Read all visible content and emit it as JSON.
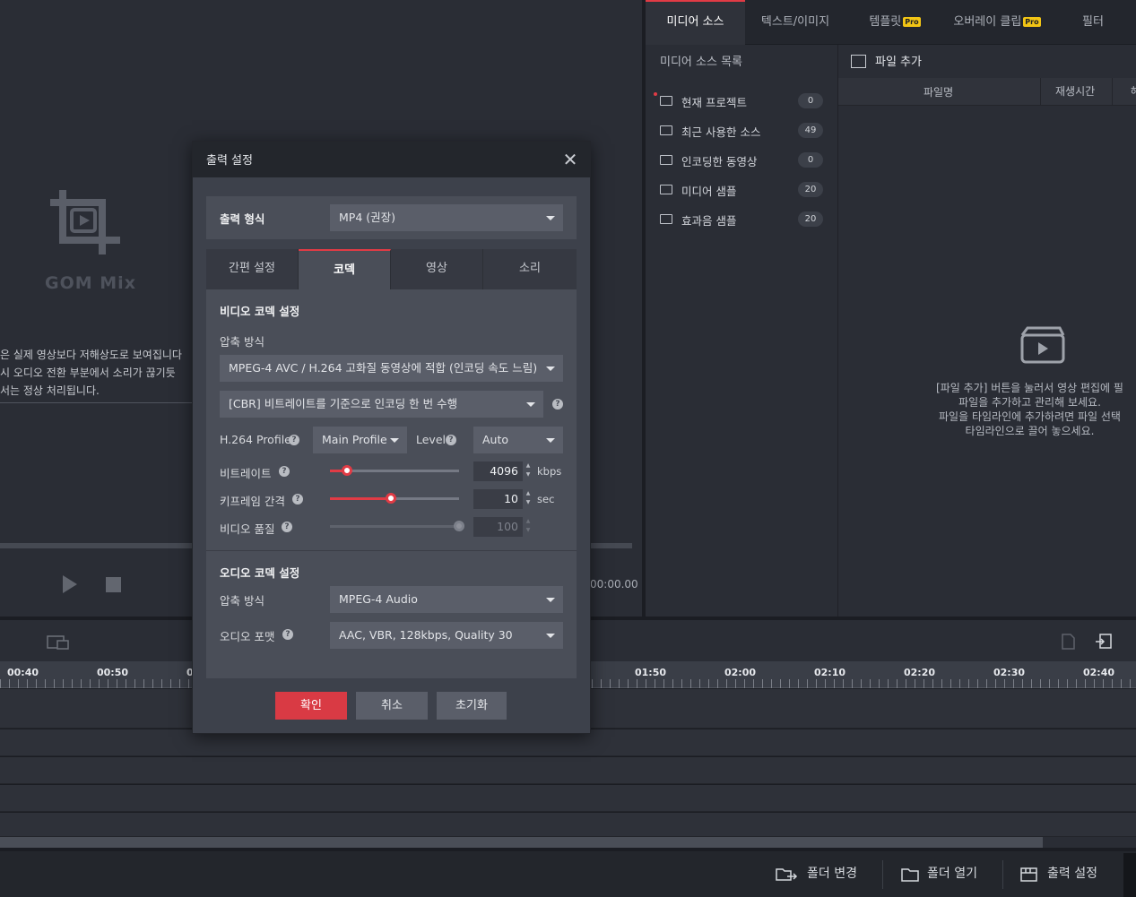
{
  "preview": {
    "logo_text": "GOM Mix",
    "notice_lines": [
      "은 실제 영상보다 저해상도로 보여집니다",
      " 시 오디오 전환 부분에서 소리가 끊기듯",
      "서는 정상 처리됩니다."
    ],
    "time_readout": "00:00.00"
  },
  "right_panel": {
    "tabs": [
      {
        "label": "미디어 소스",
        "active": true,
        "pro": false
      },
      {
        "label": "텍스트/이미지",
        "active": false,
        "pro": false
      },
      {
        "label": "템플릿",
        "active": false,
        "pro": true
      },
      {
        "label": "오버레이 클립",
        "active": false,
        "pro": true
      },
      {
        "label": "필터",
        "active": false,
        "pro": false
      }
    ],
    "pro_badge": "Pro",
    "source_list_title": "미디어 소스 목록",
    "sources": [
      {
        "label": "현재 프로젝트",
        "count": "0"
      },
      {
        "label": "최근 사용한 소스",
        "count": "49"
      },
      {
        "label": "인코딩한 동영상",
        "count": "0"
      },
      {
        "label": "미디어 샘플",
        "count": "20"
      },
      {
        "label": "효과음 샘플",
        "count": "20"
      }
    ],
    "add_file_label": "파일 추가",
    "file_columns": [
      "파일명",
      "재생시간",
      "해"
    ],
    "empty_message": [
      "[파일 추가] 버튼을 눌러서 영상 편집에 필",
      "파일을 추가하고 관리해 보세요.",
      "파일을 타임라인에 추가하려면 파일 선택",
      "타임라인으로 끌어 놓으세요."
    ]
  },
  "timeline": {
    "tick_labels": [
      "00:40",
      "00:50",
      "0",
      "01:50",
      "02:00",
      "02:10",
      "02:20",
      "02:30",
      "02:40"
    ]
  },
  "bottom_bar": {
    "change_folder": "폴더 변경",
    "open_folder": "폴더 열기",
    "output_settings": "출력 설정"
  },
  "dialog": {
    "title": "출력 설정",
    "format_label": "출력 형식",
    "format_value": "MP4 (권장)",
    "tabs": [
      "간편 설정",
      "코덱",
      "영상",
      "소리"
    ],
    "active_tab": "코덱",
    "video_section_title": "비디오 코덱 설정",
    "compression_label": "압축 방식",
    "video_codec_value": "MPEG-4 AVC / H.264 고화질 동영상에 적합 (인코딩 속도 느림)",
    "bitrate_mode_value": "[CBR] 비트레이트를 기준으로 인코딩 한 번 수행",
    "h264_profile_label": "H.264 Profile",
    "h264_profile_value": "Main Profile",
    "level_label": "Level",
    "level_value": "Auto",
    "bitrate_label": "비트레이트",
    "bitrate_value": "4096",
    "bitrate_unit": "kbps",
    "bitrate_level": 0.13,
    "keyframe_label": "키프레임 간격",
    "keyframe_value": "10",
    "keyframe_unit": "sec",
    "keyframe_level": 0.47,
    "quality_label": "비디오 품질",
    "quality_value": "100",
    "audio_section_title": "오디오 코덱 설정",
    "audio_compression_label": "압축 방식",
    "audio_codec_value": "MPEG-4 Audio",
    "audio_format_label": "오디오 포맷",
    "audio_format_value": "AAC, VBR, 128kbps, Quality 30",
    "help_glyph": "?",
    "confirm": "확인",
    "cancel": "취소",
    "reset": "초기화"
  },
  "colors": {
    "accent": "#e13b45",
    "pro": "#f2c515"
  }
}
